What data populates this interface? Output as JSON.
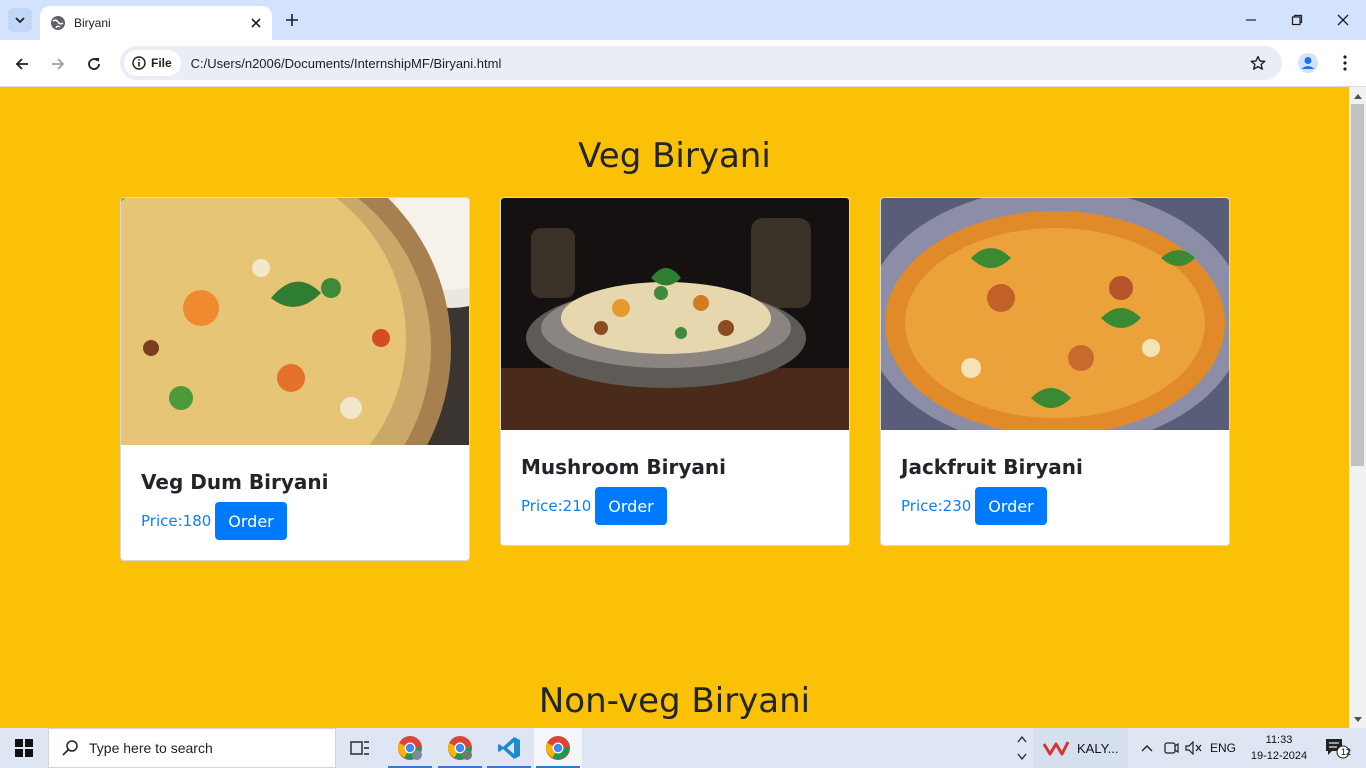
{
  "browser": {
    "tab_title": "Biryani",
    "omnibox_chip": "File",
    "url": "C:/Users/n2006/Documents/InternshipMF/Biryani.html"
  },
  "page": {
    "sections": [
      {
        "title": "Veg Biryani",
        "cards": [
          {
            "name": "Veg Dum Biryani",
            "price": "Price:180",
            "button": "Order"
          },
          {
            "name": "Mushroom Biryani",
            "price": "Price:210",
            "button": "Order"
          },
          {
            "name": "Jackfruit Biryani",
            "price": "Price:230",
            "button": "Order"
          }
        ]
      },
      {
        "title": "Non-veg Biryani"
      }
    ]
  },
  "taskbar": {
    "search_placeholder": "Type here to search",
    "weather_label": "KALY...",
    "language": "ENG",
    "time": "11:33",
    "date": "19-12-2024",
    "notification_count": "12"
  },
  "colors": {
    "page_background": "#fbc107",
    "button": "#007bff",
    "price_text": "#0d7ef7"
  }
}
